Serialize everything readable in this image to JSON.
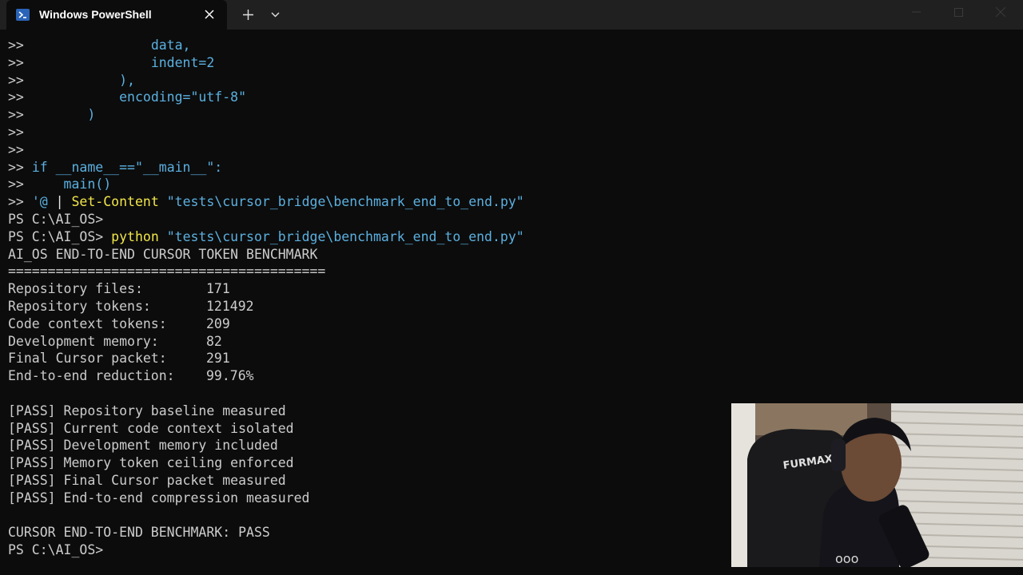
{
  "window": {
    "tab_title": "Windows PowerShell",
    "icons": {
      "tab": "powershell-icon",
      "close_tab": "close-icon",
      "new_tab": "plus-icon",
      "dropdown": "chevron-down-icon",
      "minimize": "minimize-icon",
      "maximize": "maximize-icon",
      "close_window": "close-icon"
    }
  },
  "colors": {
    "background": "#0c0c0c",
    "titlebar": "#202020",
    "text": "#cccccc",
    "keyword_blue": "#5bb0e0",
    "command_yellow": "#f2e64a"
  },
  "terminal": {
    "prompt_cont": ">>",
    "code_lines": [
      "                data,",
      "                indent=2",
      "            ),",
      "            encoding=\"utf-8\"",
      "        )",
      "",
      "",
      "if __name__==\"__main__\":",
      "    main()"
    ],
    "heredoc_start": "'@",
    "pipe": " | ",
    "set_content_cmd": "Set-Content",
    "script_path": "\"tests\\cursor_bridge\\benchmark_end_to_end.py\"",
    "prompt": "PS C:\\AI_OS>",
    "python_cmd": "python",
    "benchmark_title": "AI_OS END-TO-END CURSOR TOKEN BENCHMARK",
    "separator": "========================================",
    "metrics": [
      {
        "label": "Repository files:",
        "value": "171"
      },
      {
        "label": "Repository tokens:",
        "value": "121492"
      },
      {
        "label": "Code context tokens:",
        "value": "209"
      },
      {
        "label": "Development memory:",
        "value": "82"
      },
      {
        "label": "Final Cursor packet:",
        "value": "291"
      },
      {
        "label": "End-to-end reduction:",
        "value": "99.76%"
      }
    ],
    "checks": [
      "[PASS] Repository baseline measured",
      "[PASS] Current code context isolated",
      "[PASS] Development memory included",
      "[PASS] Memory token ceiling enforced",
      "[PASS] Final Cursor packet measured",
      "[PASS] End-to-end compression measured"
    ],
    "result": "CURSOR END-TO-END BENCHMARK: PASS"
  },
  "webcam": {
    "chair_brand": "FURMAX"
  }
}
